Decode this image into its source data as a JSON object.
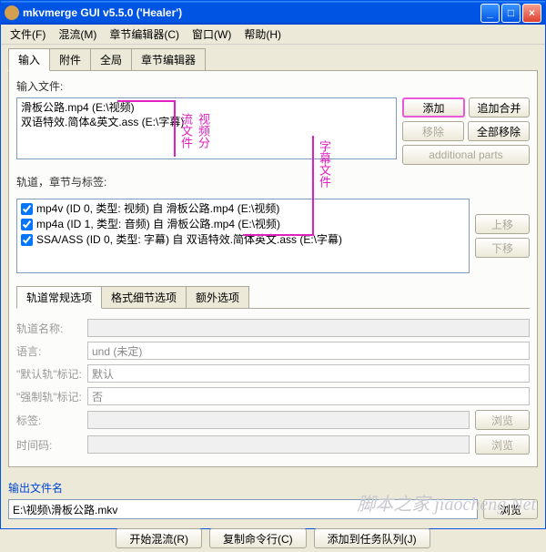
{
  "title": "mkvmerge GUI v5.5.0 ('Healer')",
  "menubar": {
    "file": "文件(F)",
    "muxing": "混流(M)",
    "chapter_editor": "章节编辑器(C)",
    "window": "窗口(W)",
    "help": "帮助(H)"
  },
  "tabs": {
    "input": "输入",
    "attachments": "附件",
    "global": "全局",
    "chapter_editor": "章节编辑器"
  },
  "labels": {
    "input_files": "输入文件:",
    "tracks": "轨道，章节与标签:",
    "output_file": "输出文件名"
  },
  "input_files": [
    "滑板公路.mp4 (E:\\视频)",
    "双语特效.简体&英文.ass (E:\\字幕)"
  ],
  "buttons": {
    "add": "添加",
    "append": "追加合并",
    "remove": "移除",
    "remove_all": "全部移除",
    "additional_parts": "additional parts",
    "move_up": "上移",
    "move_down": "下移",
    "browse": "浏览",
    "start_muxing": "开始混流(R)",
    "copy_cmdline": "复制命令行(C)",
    "add_to_queue": "添加到任务队列(J)"
  },
  "tracks": [
    {
      "checked": true,
      "label": "mp4v (ID 0, 类型: 视频) 自 滑板公路.mp4 (E:\\视频)"
    },
    {
      "checked": true,
      "label": "mp4a (ID 1, 类型: 音频) 自 滑板公路.mp4 (E:\\视频)"
    },
    {
      "checked": true,
      "label": "SSA/ASS (ID 0, 类型: 字幕) 自 双语特效.简体英文.ass (E:\\字幕)"
    }
  ],
  "inner_tabs": {
    "general": "轨道常规选项",
    "format": "格式细节选项",
    "extra": "额外选项"
  },
  "fields": {
    "track_name": {
      "label": "轨道名称:",
      "value": ""
    },
    "language": {
      "label": "语言:",
      "value": "und (未定)"
    },
    "default_flag": {
      "label": "\"默认轨\"标记:",
      "value": "默认"
    },
    "forced_flag": {
      "label": "\"强制轨\"标记:",
      "value": "否"
    },
    "tags": {
      "label": "标签:",
      "value": ""
    },
    "timecodes": {
      "label": "时间码:",
      "value": ""
    }
  },
  "output_file": "E:\\视频\\滑板公路.mkv",
  "annotations": {
    "video_split": "视频分流文件",
    "subtitle_file": "字幕文件"
  },
  "watermark": "脚本之家  jiaocheng.Net"
}
